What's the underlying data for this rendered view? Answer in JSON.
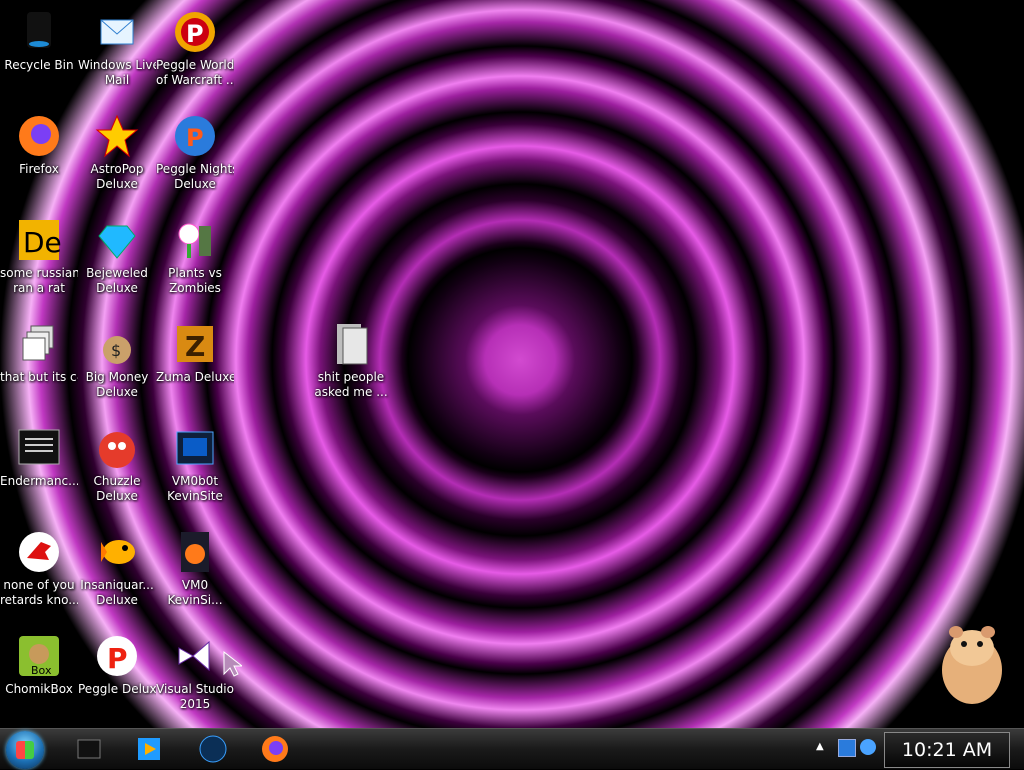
{
  "desktop": {
    "icons": [
      {
        "label1": "Recycle Bin",
        "label2": "",
        "icon": "recycle-bin-icon"
      },
      {
        "label1": "Windows Live",
        "label2": "Mail",
        "icon": "mail-icon"
      },
      {
        "label1": "Peggle World",
        "label2": "of Warcraft ...",
        "icon": "peggle-icon"
      },
      {
        "label1": "Firefox",
        "label2": "",
        "icon": "firefox-icon"
      },
      {
        "label1": "AstroPop",
        "label2": "Deluxe",
        "icon": "astropop-icon"
      },
      {
        "label1": "Peggle Nights",
        "label2": "Deluxe",
        "icon": "peggle-nights-icon"
      },
      {
        "label1": "some russian",
        "label2": "ran a rat",
        "icon": "de-icon"
      },
      {
        "label1": "Bejeweled",
        "label2": "Deluxe",
        "icon": "gem-icon"
      },
      {
        "label1": "Plants vs",
        "label2": "Zombies",
        "icon": "plants-icon"
      },
      {
        "label1": "that but its c#",
        "label2": "",
        "icon": "stack-icon"
      },
      {
        "label1": "Big Money",
        "label2": "Deluxe",
        "icon": "money-bag-icon"
      },
      {
        "label1": "Zuma Deluxe",
        "label2": "",
        "icon": "zuma-icon"
      },
      {
        "label1": "Endermanc...",
        "label2": "",
        "icon": "terminal-icon"
      },
      {
        "label1": "Chuzzle",
        "label2": "Deluxe",
        "icon": "chuzzle-icon"
      },
      {
        "label1": "VM0b0t",
        "label2": "KevinSite",
        "icon": "vm-folder-icon"
      },
      {
        "label1": "none of you",
        "label2": "retards kno...",
        "icon": "dino-icon"
      },
      {
        "label1": "Insaniquar...",
        "label2": "Deluxe",
        "icon": "fish-icon"
      },
      {
        "label1": "VM0",
        "label2": "KevinSi...",
        "icon": "firefox-file-icon"
      },
      {
        "label1": "ChomikBox",
        "label2": "",
        "icon": "chomikbox-icon"
      },
      {
        "label1": "Peggle Deluxe",
        "label2": "",
        "icon": "peggle-deluxe-icon"
      },
      {
        "label1": "Visual Studio",
        "label2": "2015",
        "icon": "visual-studio-icon"
      },
      {
        "label1": "shit people",
        "label2": "asked me ...",
        "icon": "folder-icon"
      }
    ]
  },
  "taskbar": {
    "start": "start-orb-icon",
    "pinned": [
      "window-icon",
      "media-player-icon",
      "globe-icon",
      "firefox-icon"
    ],
    "clock": "10:21 AM"
  }
}
